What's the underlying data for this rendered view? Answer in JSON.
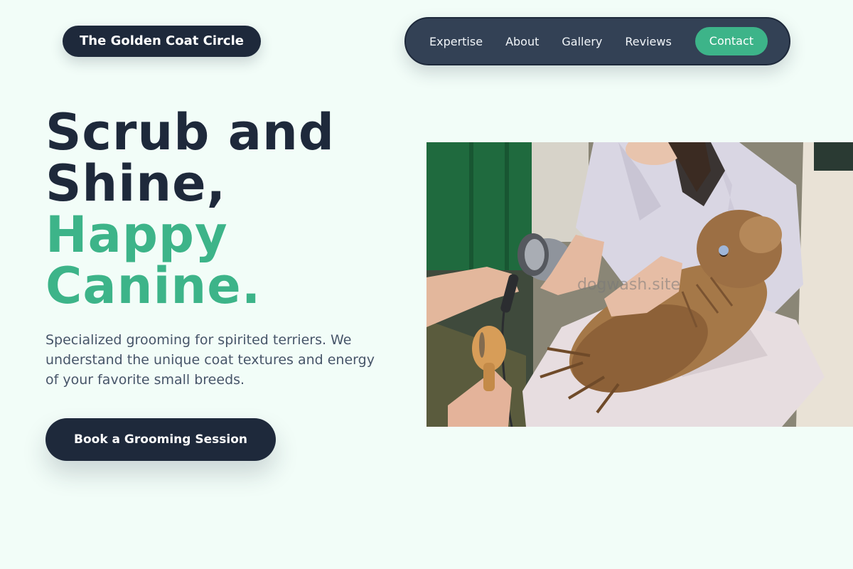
{
  "brand": {
    "name": "The Golden Coat Circle"
  },
  "nav": {
    "links": [
      "Expertise",
      "About",
      "Gallery",
      "Reviews"
    ],
    "cta_label": "Contact"
  },
  "hero": {
    "title_line1": "Scrub and",
    "title_line2": "Shine,",
    "title_accent_line1": "Happy",
    "title_accent_line2": "Canine.",
    "description": "Specialized grooming for spirited terriers. We understand the unique coat textures and energy of your favorite small breeds.",
    "cta_label": "Book a Grooming Session",
    "image": {
      "subject": "groomer blow-drying a small long-haired terrier wrapped in a towel while another hand holds a brush",
      "watermark": "dogwash.site"
    }
  },
  "colors": {
    "background": "#f2fdf8",
    "navy": "#1e293b",
    "nav_bg": "#334155",
    "accent_green": "#3db489",
    "body_text": "#475569"
  }
}
